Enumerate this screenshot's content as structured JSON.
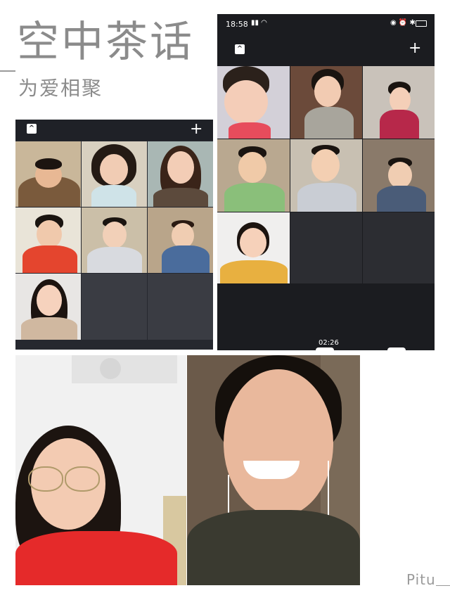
{
  "title": "空中茶话",
  "subtitle": "为爱相聚",
  "phone": {
    "time": "18:58",
    "timer": "02:26"
  },
  "left_panel": {
    "collapse_icon": "chevron-up-icon",
    "add_icon": "plus-icon"
  },
  "watermark": "Pitu"
}
